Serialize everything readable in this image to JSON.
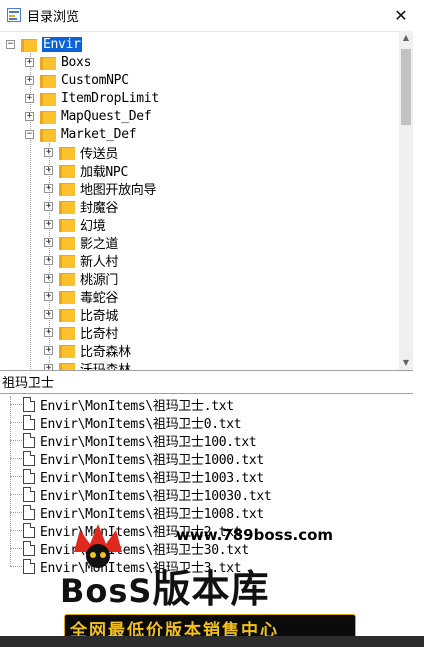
{
  "window": {
    "title": "目录浏览",
    "close_label": "✕"
  },
  "tree": {
    "root": {
      "label": "Envir",
      "expanded": true,
      "selected": true
    },
    "level1": [
      {
        "label": "Boxs",
        "expanded": false
      },
      {
        "label": "CustomNPC",
        "expanded": false
      },
      {
        "label": "ItemDropLimit",
        "expanded": false
      },
      {
        "label": "MapQuest_Def",
        "expanded": false
      },
      {
        "label": "Market_Def",
        "expanded": true
      }
    ],
    "market_children": [
      {
        "label": "传送员"
      },
      {
        "label": "加载NPC"
      },
      {
        "label": "地图开放向导"
      },
      {
        "label": "封魔谷"
      },
      {
        "label": "幻境"
      },
      {
        "label": "影之道"
      },
      {
        "label": "新人村"
      },
      {
        "label": "桃源门"
      },
      {
        "label": "毒蛇谷"
      },
      {
        "label": "比奇城"
      },
      {
        "label": "比奇村"
      },
      {
        "label": "比奇森林"
      },
      {
        "label": "沃玛森林"
      }
    ],
    "expander_collapsed": "+",
    "expander_expanded": "−"
  },
  "search": {
    "value": "祖玛卫士"
  },
  "results": [
    "Envir\\MonItems\\祖玛卫士.txt",
    "Envir\\MonItems\\祖玛卫士0.txt",
    "Envir\\MonItems\\祖玛卫士100.txt",
    "Envir\\MonItems\\祖玛卫士1000.txt",
    "Envir\\MonItems\\祖玛卫士1003.txt",
    "Envir\\MonItems\\祖玛卫士10030.txt",
    "Envir\\MonItems\\祖玛卫士1008.txt",
    "Envir\\MonItems\\祖玛卫士2.txt",
    "Envir\\MonItems\\祖玛卫士30.txt",
    "Envir\\MonItems\\祖玛卫士3.txt"
  ],
  "watermark": {
    "url": "www.789boss.com",
    "brand_latin": "BosS",
    "brand_cjk": "版本库",
    "slogan": "全网最低价版本销售中心"
  },
  "colors": {
    "folder": "#fdc12c",
    "selection": "#0a64d8",
    "watermark_gold": "#f1c01c"
  }
}
